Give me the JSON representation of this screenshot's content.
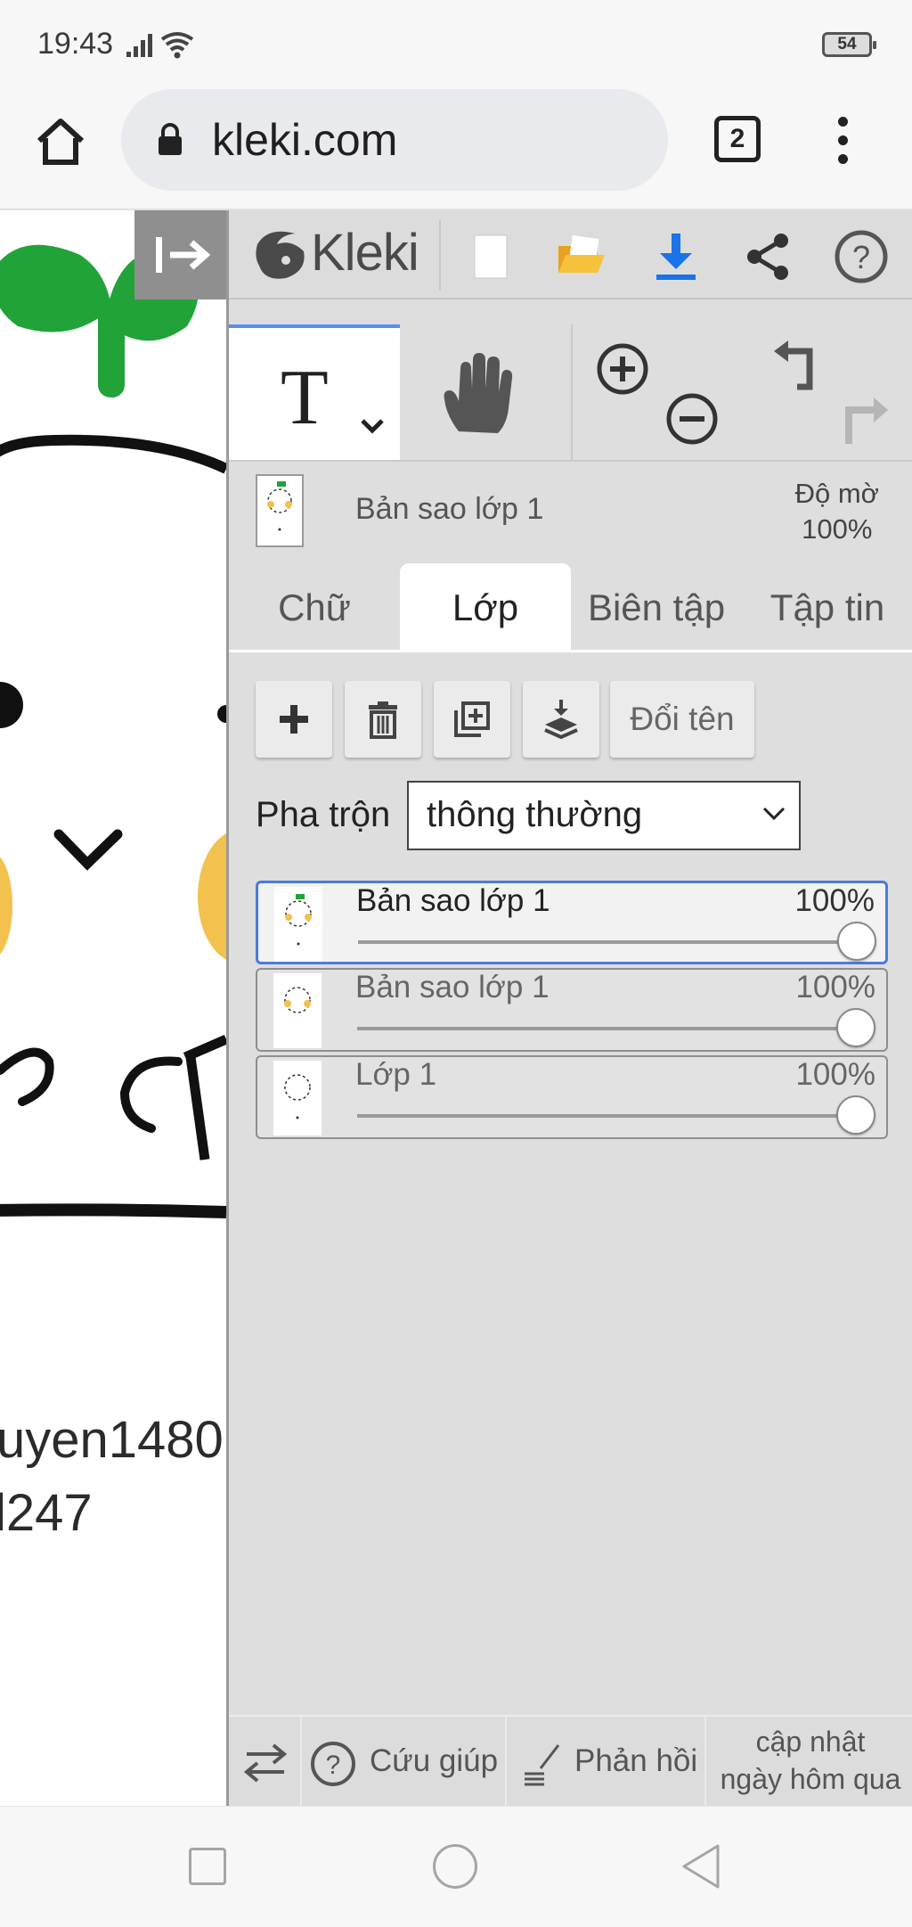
{
  "status": {
    "time": "19:43",
    "battery": "54"
  },
  "browser": {
    "url": "kleki.com",
    "tab_count": "2"
  },
  "canvas": {
    "text_line1": "uyen1480",
    "text_line2": "l247"
  },
  "app": {
    "logo_text": "Kleki",
    "layer_info": {
      "name": "Bản sao lớp 1",
      "opacity_label": "Độ mờ",
      "opacity_value": "100%"
    },
    "tabs": [
      "Chữ",
      "Lớp",
      "Biên tập",
      "Tập tin"
    ],
    "active_tab": "Lớp",
    "rename_label": "Đổi tên",
    "blend": {
      "label": "Pha trộn",
      "value": "thông thường"
    },
    "layers": [
      {
        "name": "Bản sao lớp 1",
        "opacity": "100%",
        "opacity_value": 1.0,
        "selected": true
      },
      {
        "name": "Bản sao lớp 1",
        "opacity": "100%",
        "opacity_value": 1.0,
        "selected": false
      },
      {
        "name": "Lớp 1",
        "opacity": "100%",
        "opacity_value": 1.0,
        "selected": false
      }
    ],
    "footer": {
      "help": "Cứu giúp",
      "feedback": "Phản hồi",
      "update_line1": "cập nhật",
      "update_line2": "ngày hôm qua"
    },
    "accent_color": "#4a7be0",
    "download_color": "#1a73e8"
  }
}
